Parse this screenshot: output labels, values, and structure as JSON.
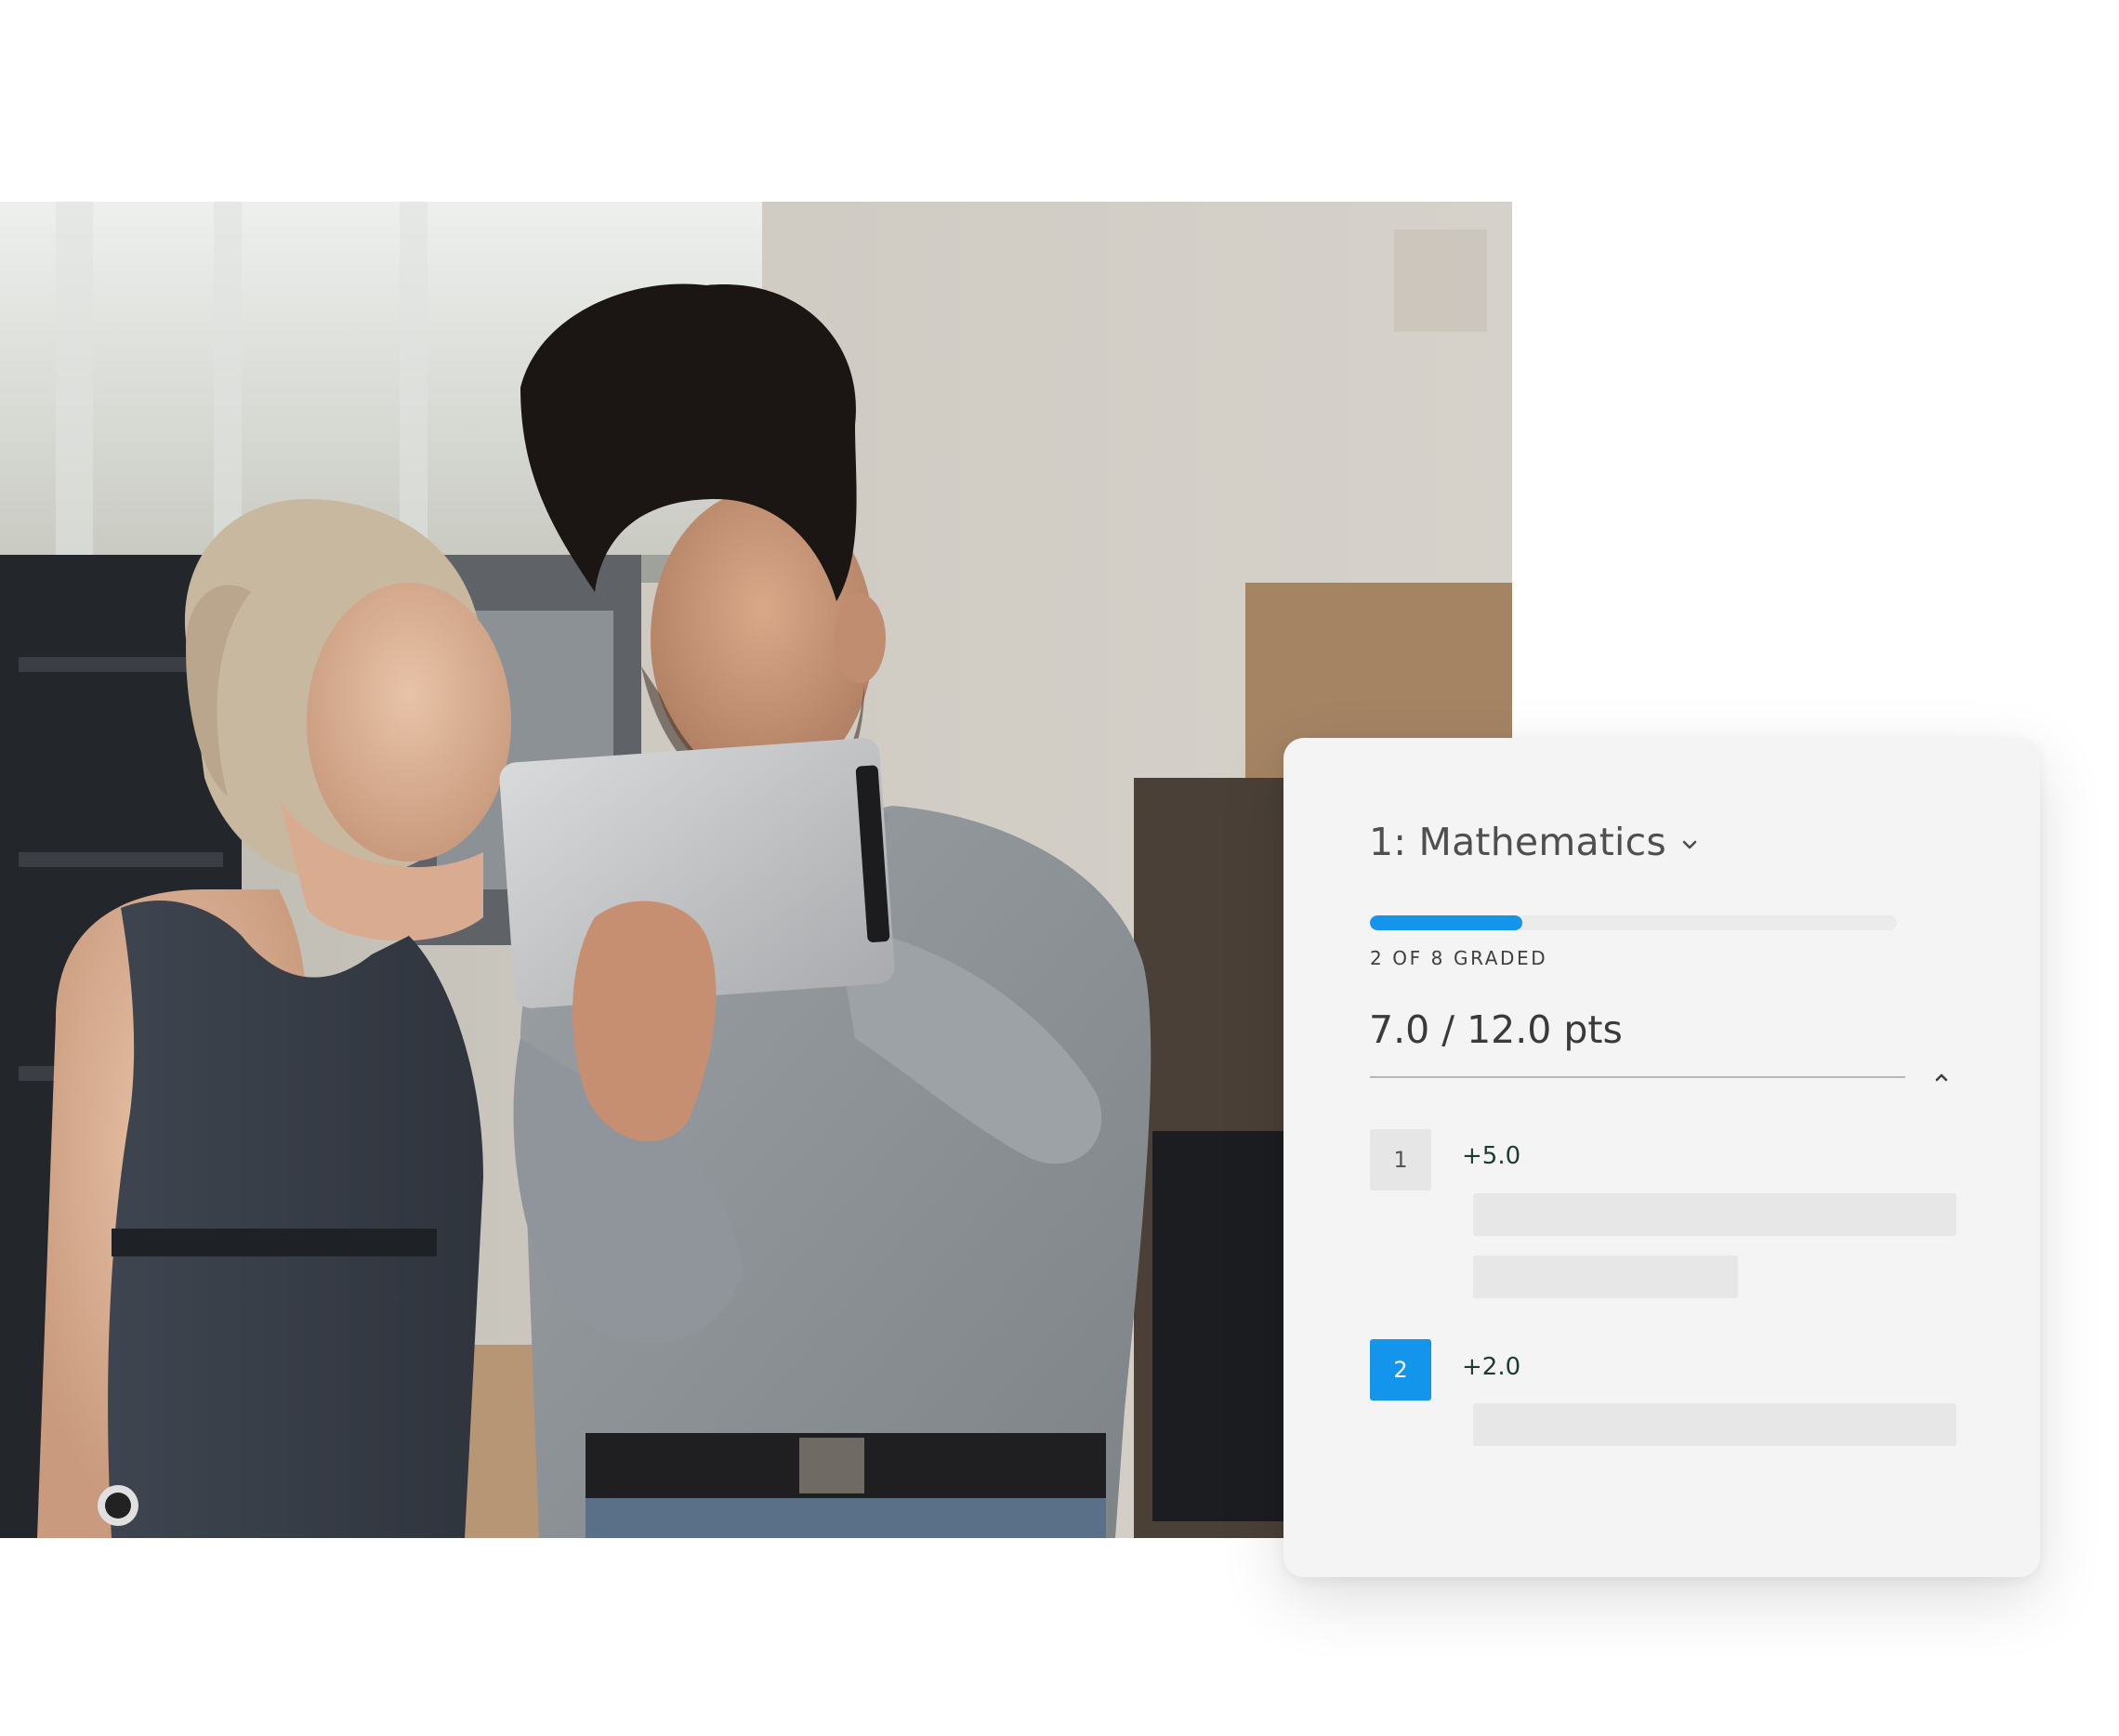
{
  "grading_card": {
    "title": "1: Mathematics",
    "progress": {
      "graded": 2,
      "total": 8,
      "fraction": 0.289,
      "label": "2 OF 8 GRADED"
    },
    "score_text": "7.0 / 12.0 pts",
    "items": [
      {
        "number": "1",
        "points": "+5.0",
        "selected": false
      },
      {
        "number": "2",
        "points": "+2.0",
        "selected": true
      }
    ]
  },
  "colors": {
    "accent": "#1495ec",
    "card_background": "#f4f4f4",
    "points_text": "#1b3b33"
  },
  "icons": {
    "title_dropdown": "chevron-down-icon",
    "collapse_toggle": "chevron-up-icon"
  }
}
